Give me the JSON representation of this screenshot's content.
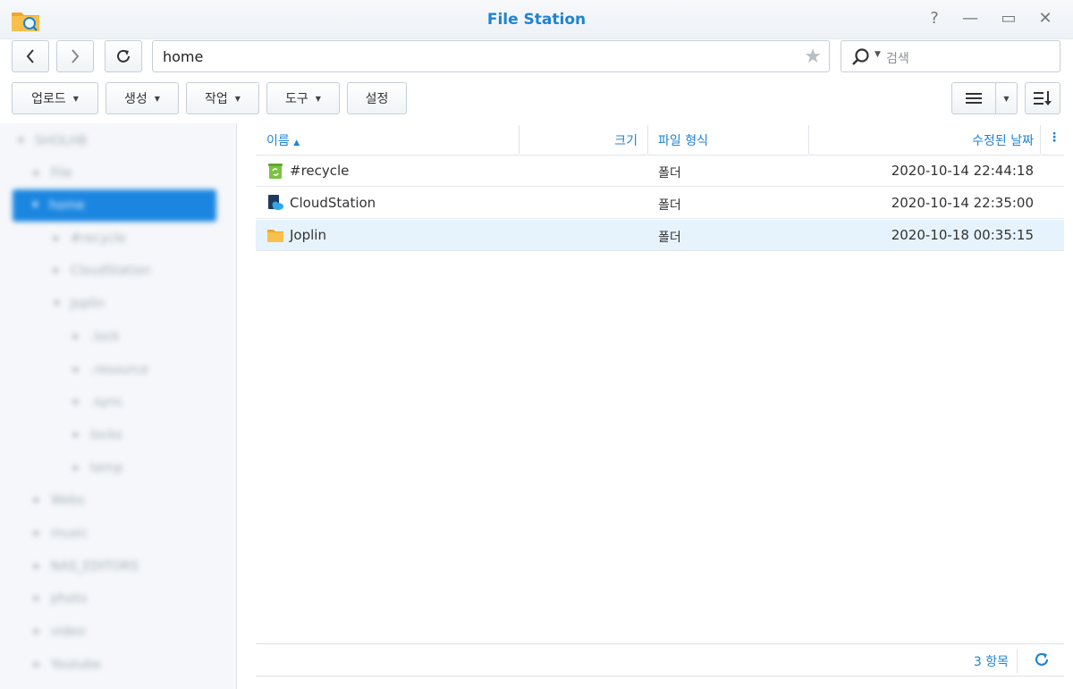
{
  "window": {
    "title": "File Station",
    "help_glyph": "?",
    "minimize_glyph": "—",
    "maximize_glyph": "▭",
    "close_glyph": "✕"
  },
  "nav": {
    "back_icon": "chevron-left-icon",
    "forward_icon": "chevron-right-icon",
    "refresh_icon": "refresh-icon",
    "path": "home",
    "favorite_icon": "star-icon"
  },
  "search": {
    "placeholder": "검색"
  },
  "toolbar": {
    "upload_label": "업로드",
    "create_label": "생성",
    "action_label": "작업",
    "tools_label": "도구",
    "settings_label": "설정"
  },
  "sidebar": {
    "items": [
      {
        "label": "SHOLHB"
      },
      {
        "label": "File"
      },
      {
        "label": "home"
      },
      {
        "label": "#recycle"
      },
      {
        "label": "CloudStation"
      },
      {
        "label": "Joplin"
      },
      {
        "label": ".lock"
      },
      {
        "label": ".resource"
      },
      {
        "label": ".sync"
      },
      {
        "label": "locks"
      },
      {
        "label": "temp"
      },
      {
        "label": "Webs"
      },
      {
        "label": "music"
      },
      {
        "label": "NAS_EDITORS"
      },
      {
        "label": "photo"
      },
      {
        "label": "video"
      },
      {
        "label": "Youtube"
      }
    ]
  },
  "table": {
    "headers": {
      "name": "이름",
      "size": "크기",
      "type": "파일 형식",
      "modified": "수정된 날짜"
    },
    "rows": [
      {
        "name": "#recycle",
        "type": "폴더",
        "modified": "2020-10-14 22:44:18",
        "icon": "recycle-folder-icon"
      },
      {
        "name": "CloudStation",
        "type": "폴더",
        "modified": "2020-10-14 22:35:00",
        "icon": "cloud-station-folder-icon"
      },
      {
        "name": "Joplin",
        "type": "폴더",
        "modified": "2020-10-18 00:35:15",
        "icon": "folder-icon",
        "selected": true
      }
    ]
  },
  "footer": {
    "count": "3 항목"
  },
  "colors": {
    "accent": "#1f83d1",
    "selection": "#1b86e0",
    "row_selected": "#e6f3fd"
  }
}
